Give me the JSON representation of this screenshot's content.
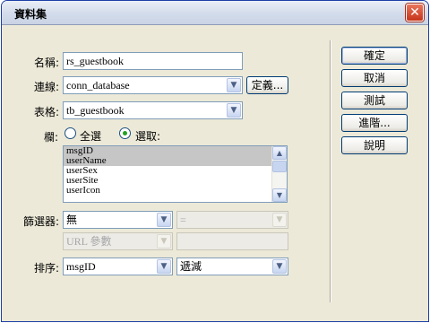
{
  "window": {
    "title": "資料集",
    "close_glyph": "✕"
  },
  "form": {
    "name_label": "名稱:",
    "name_value": "rs_guestbook",
    "connection_label": "連線:",
    "connection_value": "conn_database",
    "define_button": "定義...",
    "table_label": "表格:",
    "table_value": "tb_guestbook",
    "columns_label": "欄:",
    "columns_all_label": "全選",
    "columns_selected_label": "選取:",
    "columns_mode": "selected",
    "columns_list": [
      "msgID",
      "userName",
      "userSex",
      "userSite",
      "userIcon"
    ],
    "columns_selected_items": [
      "msgID",
      "userName"
    ],
    "filter_label": "篩選器:",
    "filter_value": "無",
    "filter_operator": "=",
    "filter_source": "URL 參數",
    "filter_input": "",
    "sort_label": "排序:",
    "sort_column": "msgID",
    "sort_order": "遞減"
  },
  "buttons": {
    "ok": "確定",
    "cancel": "取消",
    "test": "測試",
    "advanced": "進階...",
    "help": "說明"
  },
  "icons": {
    "dropdown": "chevron-down-icon",
    "scroll_up": "scroll-up-arrow-icon",
    "scroll_down": "scroll-down-arrow-icon",
    "close": "close-icon"
  }
}
